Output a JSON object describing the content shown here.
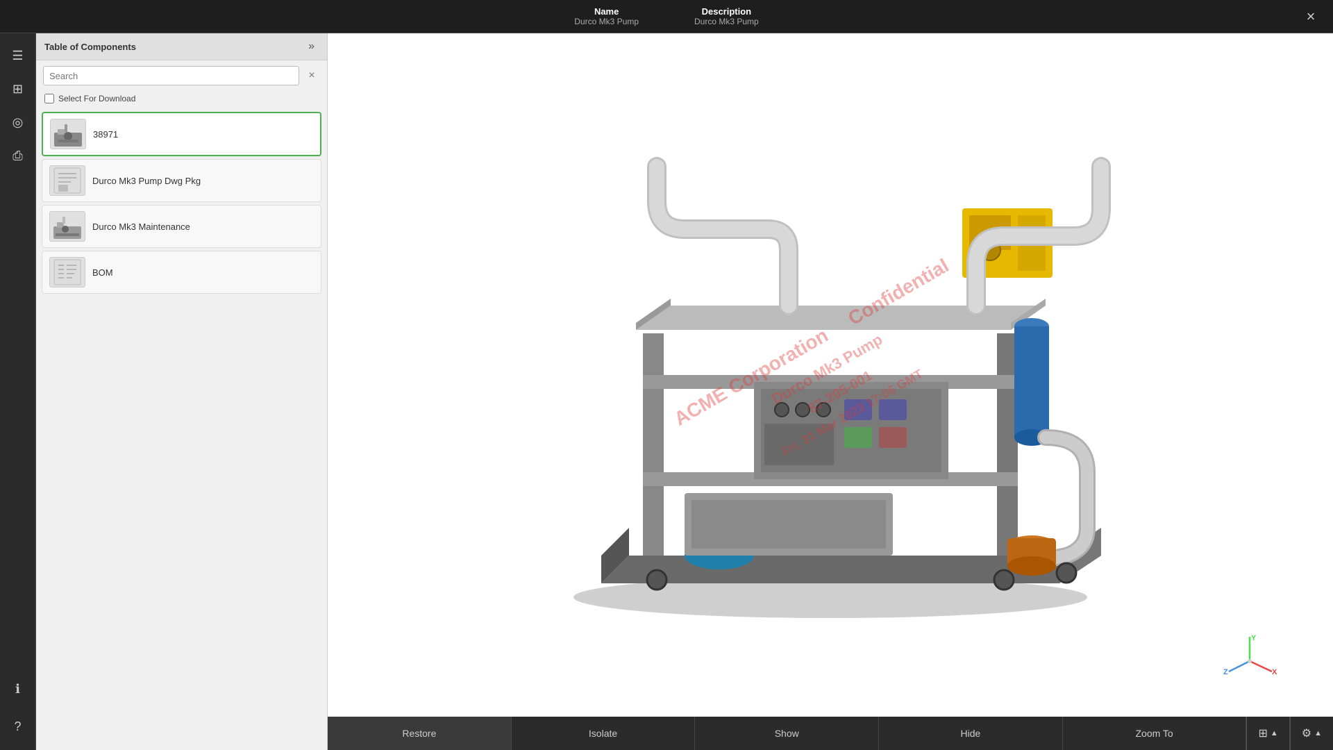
{
  "header": {
    "name_label": "Name",
    "desc_label": "Description",
    "name_value": "Durco Mk3 Pump",
    "desc_value": "Durco Mk3 Pump",
    "close_label": "×"
  },
  "panel": {
    "title": "Table of Components",
    "search_placeholder": "Search",
    "select_for_download": "Select For Download",
    "expand_icon": "»"
  },
  "components": [
    {
      "id": "38971",
      "name": "38971",
      "active": true,
      "thumb_type": "pump-assembly"
    },
    {
      "id": "durco-dwg",
      "name": "Durco Mk3 Pump Dwg Pkg",
      "active": false,
      "thumb_type": "drawing"
    },
    {
      "id": "durco-maint",
      "name": "Durco Mk3 Maintenance",
      "active": false,
      "thumb_type": "maintenance"
    },
    {
      "id": "bom",
      "name": "BOM",
      "active": false,
      "thumb_type": "bom"
    }
  ],
  "watermark": {
    "lines": [
      "ACME Corporation Confidential",
      "Durco Mk3 Pump",
      "87-205-001",
      "Fri, 31 Mar 2023 17:06 GMT"
    ]
  },
  "axes": {
    "x_label": "X",
    "y_label": "Y",
    "z_label": "Z"
  },
  "toolbar": {
    "restore_label": "Restore",
    "isolate_label": "Isolate",
    "show_label": "Show",
    "hide_label": "Hide",
    "zoom_to_label": "Zoom To"
  },
  "sidebar_icons": [
    {
      "name": "list-icon",
      "icon": "☰"
    },
    {
      "name": "layers-icon",
      "icon": "⧉"
    },
    {
      "name": "camera-icon",
      "icon": "◉"
    },
    {
      "name": "print-icon",
      "icon": "⎙"
    }
  ],
  "sidebar_bottom_icons": [
    {
      "name": "info-icon",
      "icon": "ℹ"
    },
    {
      "name": "help-icon",
      "icon": "?"
    }
  ]
}
